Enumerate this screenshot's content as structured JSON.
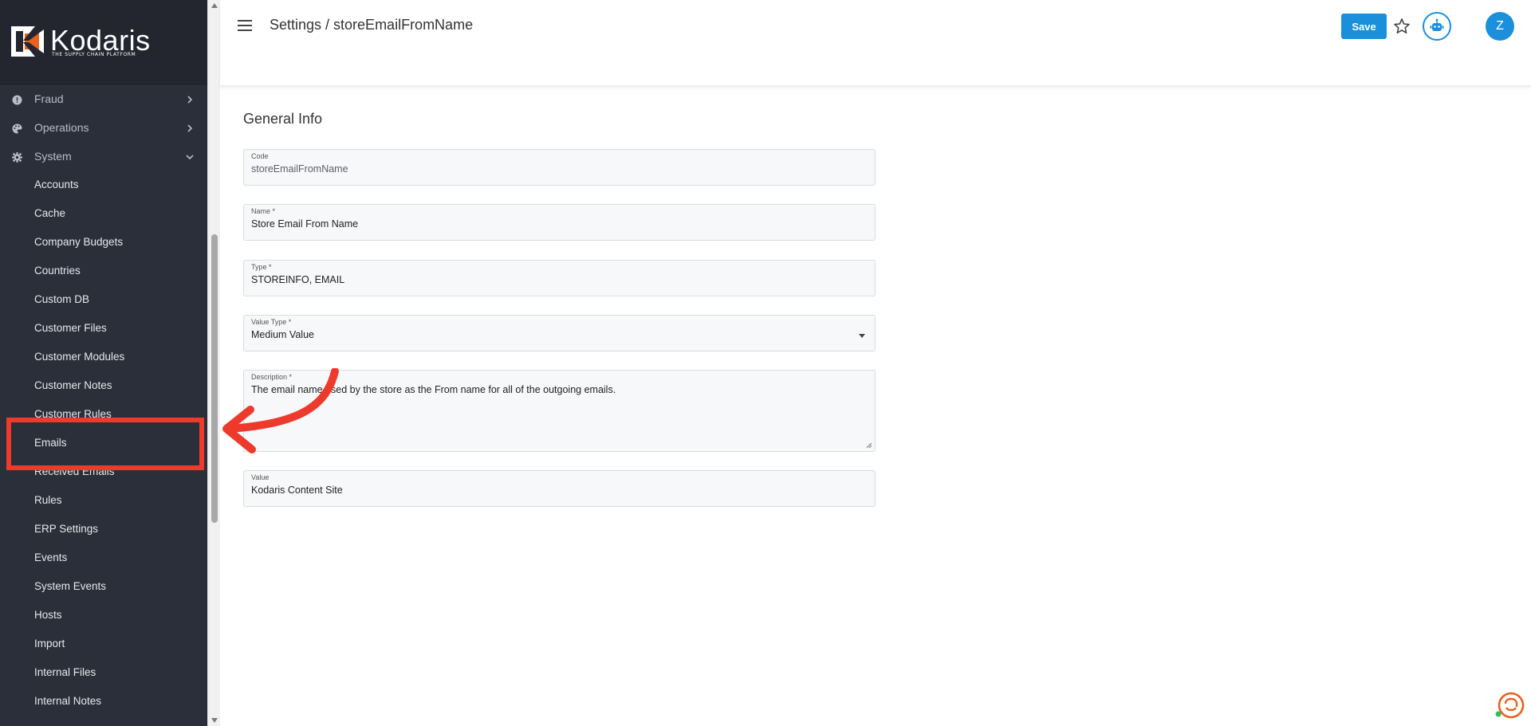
{
  "brand": {
    "name": "Kodaris",
    "tagline": "THE SUPPLY CHAIN PLATFORM",
    "accent": "#e8611f"
  },
  "sidebar": {
    "groups": [
      {
        "label": "Fraud",
        "icon": "alert-circle-icon",
        "state": "collapsed"
      },
      {
        "label": "Operations",
        "icon": "palette-icon",
        "state": "collapsed"
      },
      {
        "label": "System",
        "icon": "gear-icon",
        "state": "expanded"
      }
    ],
    "items": [
      {
        "label": "Accounts"
      },
      {
        "label": "Cache"
      },
      {
        "label": "Company Budgets"
      },
      {
        "label": "Countries"
      },
      {
        "label": "Custom DB"
      },
      {
        "label": "Customer Files"
      },
      {
        "label": "Customer Modules"
      },
      {
        "label": "Customer Notes"
      },
      {
        "label": "Customer Rules"
      },
      {
        "label": "Emails"
      },
      {
        "label": "Received Emails"
      },
      {
        "label": "Rules"
      },
      {
        "label": "ERP Settings"
      },
      {
        "label": "Events"
      },
      {
        "label": "System Events"
      },
      {
        "label": "Hosts"
      },
      {
        "label": "Import"
      },
      {
        "label": "Internal Files"
      },
      {
        "label": "Internal Notes"
      }
    ],
    "highlighted_item": "Emails"
  },
  "header": {
    "breadcrumb": "Settings / storeEmailFromName",
    "save_label": "Save",
    "avatar_initial": "Z",
    "primary_color": "#1a8fdc"
  },
  "form": {
    "section_title": "General Info",
    "code": {
      "label": "Code",
      "value": "storeEmailFromName"
    },
    "name": {
      "label": "Name *",
      "value": "Store Email From Name"
    },
    "type": {
      "label": "Type *",
      "value": "STOREINFO, EMAIL"
    },
    "value_type": {
      "label": "Value Type *",
      "value": "Medium Value"
    },
    "description": {
      "label": "Description *",
      "value": "The email name used by the store as the From name for all of the outgoing emails."
    },
    "value": {
      "label": "Value",
      "value": "Kodaris Content Site"
    }
  },
  "annotation": {
    "color": "#ee3a2c",
    "target": "Emails"
  }
}
